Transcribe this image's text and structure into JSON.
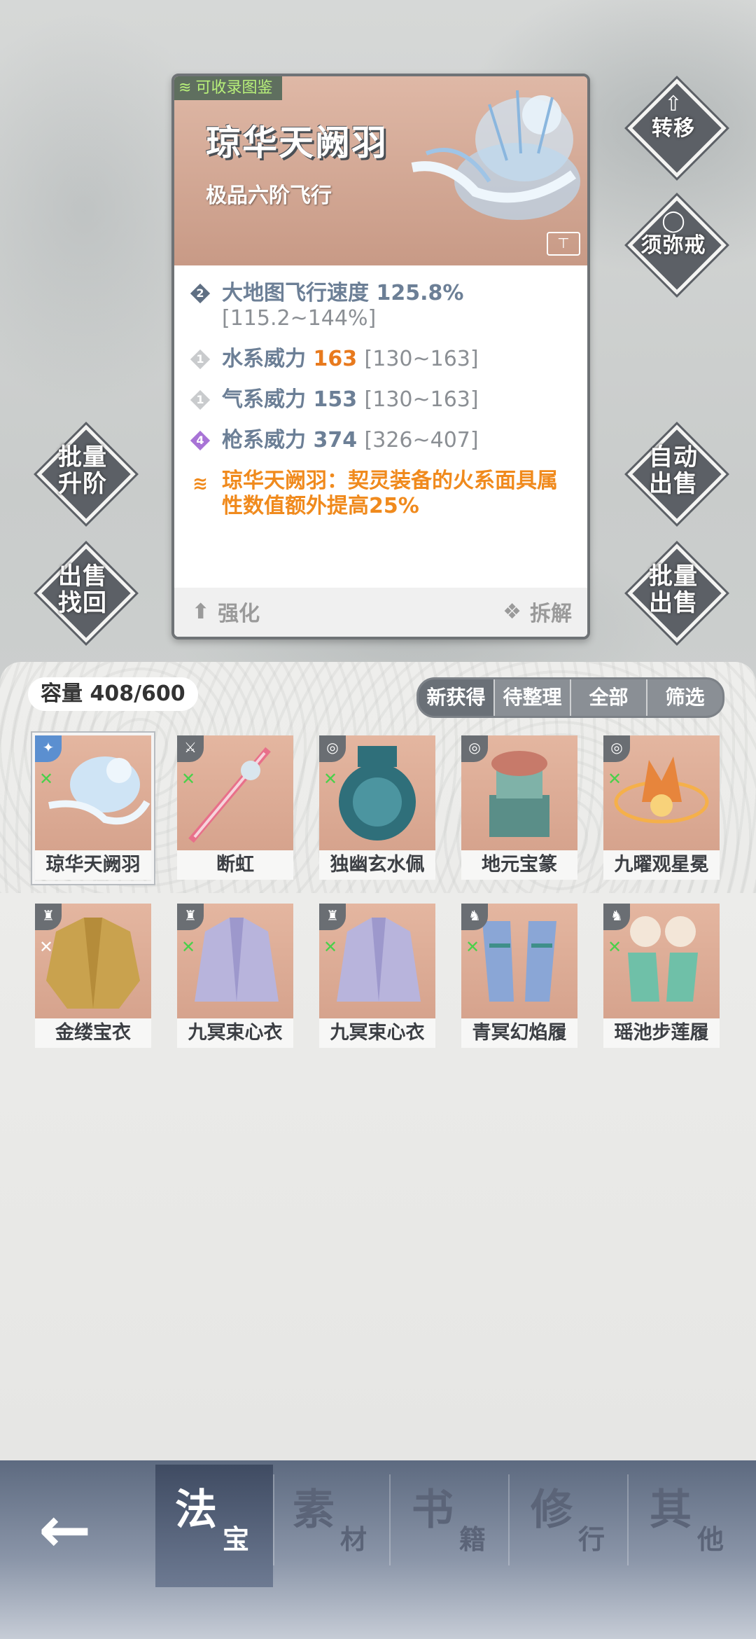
{
  "side_buttons": {
    "transfer": "转移",
    "sumeru_ring": "须弥戒",
    "batch_upgrade": "批量\n升阶",
    "auto_sell": "自动\n出售",
    "sell_recover": "出售\n找回",
    "batch_sell": "批量\n出售"
  },
  "detail": {
    "tag": "可收录图鉴",
    "name": "琼华天阙羽",
    "subtitle": "极品六阶飞行",
    "stats": [
      {
        "rank": "2",
        "rank_color": "#5f6f83",
        "label": "大地图飞行速度",
        "value": "125.8%",
        "range": "[115.2~144%]"
      },
      {
        "rank": "1",
        "rank_color": "#c9cbcd",
        "label": "水系威力",
        "value": "163",
        "range": "[130~163]"
      },
      {
        "rank": "1",
        "rank_color": "#c9cbcd",
        "label": "气系威力",
        "value": "153",
        "range": "[130~163]"
      },
      {
        "rank": "4",
        "rank_color": "#a873d6",
        "label": "枪系威力",
        "value": "374",
        "range": "[326~407]"
      }
    ],
    "special": "琼华天阙羽：契灵装备的火系面具属性数值额外提高25%",
    "strengthen": "强化",
    "dismantle": "拆解"
  },
  "inventory": {
    "capacity": "容量 408/600",
    "tabs": [
      "新获得",
      "待整理",
      "全部",
      "筛选"
    ],
    "items": [
      {
        "name": "琼华天阙羽",
        "icon": "feather-icon"
      },
      {
        "name": "断虹",
        "icon": "sword-icon"
      },
      {
        "name": "独幽玄水佩",
        "icon": "pendant-icon"
      },
      {
        "name": "地元宝篆",
        "icon": "seal-icon"
      },
      {
        "name": "九曜观星冕",
        "icon": "crown-icon"
      },
      {
        "name": "金缕宝衣",
        "icon": "robe-icon"
      },
      {
        "name": "九冥束心衣",
        "icon": "robe-icon"
      },
      {
        "name": "九冥束心衣",
        "icon": "robe-icon"
      },
      {
        "name": "青冥幻焰履",
        "icon": "boots-icon"
      },
      {
        "name": "瑶池步莲履",
        "icon": "boots-icon"
      }
    ]
  },
  "nav": {
    "back_icon": "back-arrow-icon",
    "tabs": [
      {
        "big": "法",
        "small": "宝"
      },
      {
        "big": "素",
        "small": "材"
      },
      {
        "big": "书",
        "small": "籍"
      },
      {
        "big": "修",
        "small": "行"
      },
      {
        "big": "其",
        "small": "他"
      }
    ]
  }
}
